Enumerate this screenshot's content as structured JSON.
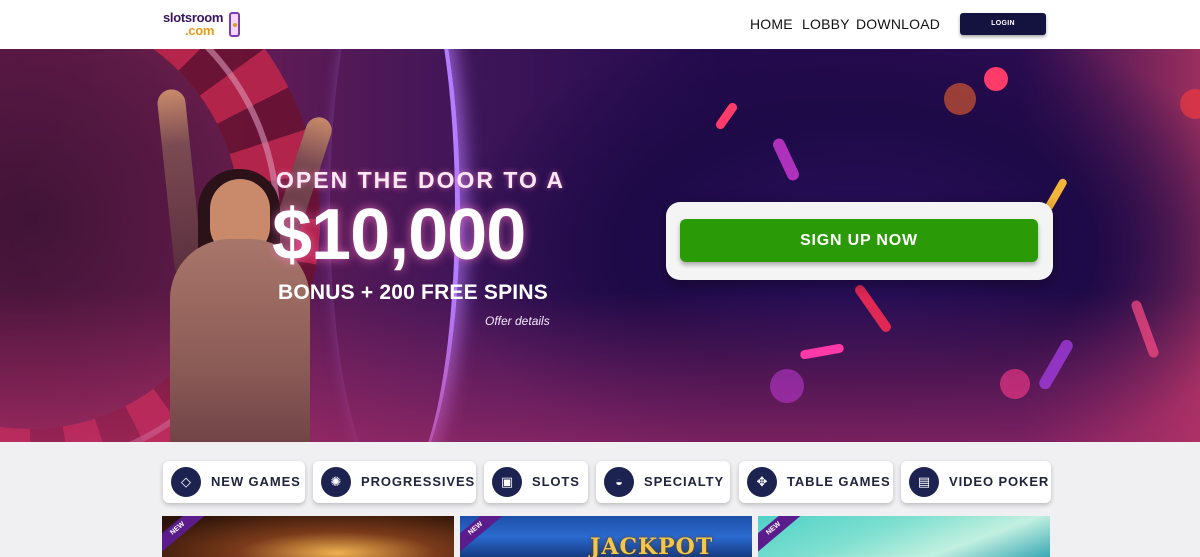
{
  "header": {
    "logo_line1": "slotsroom",
    "logo_line2": ".com",
    "nav": [
      "HOME",
      "LOBBY",
      "DOWNLOAD"
    ],
    "login_label": "LOGIN"
  },
  "hero": {
    "headline_top": "OPEN THE DOOR TO A",
    "headline_amount": "$10,000",
    "headline_bonus": "BONUS + 200 FREE SPINS",
    "offer_details": "Offer details",
    "signup_label": "SIGN UP NOW"
  },
  "categories": [
    {
      "label": "NEW GAMES",
      "icon": "diamond-icon",
      "glyph": "◇"
    },
    {
      "label": "PROGRESSIVES",
      "icon": "progressive-icon",
      "glyph": "✺"
    },
    {
      "label": "SLOTS",
      "icon": "slot-machine-icon",
      "glyph": "▣"
    },
    {
      "label": "SPECIALTY",
      "icon": "specialty-icon",
      "glyph": "◒"
    },
    {
      "label": "TABLE GAMES",
      "icon": "table-games-icon",
      "glyph": "✥"
    },
    {
      "label": "VIDEO POKER",
      "icon": "video-poker-icon",
      "glyph": "▤"
    }
  ],
  "tiles": [
    {
      "ribbon": "NEW",
      "title": ""
    },
    {
      "ribbon": "NEW",
      "title": "JACKPOT"
    },
    {
      "ribbon": "NEW",
      "title": ""
    }
  ],
  "colors": {
    "nav_dark": "#14123e",
    "signup_green": "#2a9a07",
    "category_icon_bg": "#1c2350"
  }
}
